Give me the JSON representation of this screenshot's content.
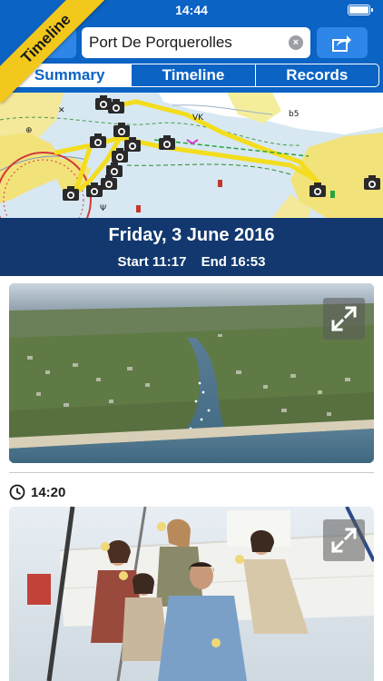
{
  "status_bar": {
    "time": "14:44"
  },
  "ribbon": {
    "label": "Timeline"
  },
  "search": {
    "value": "Port De Porquerolles"
  },
  "tabs": [
    {
      "label": "Summary",
      "active": true
    },
    {
      "label": "Timeline",
      "active": false
    },
    {
      "label": "Records",
      "active": false
    }
  ],
  "trip": {
    "date": "Friday, 3 June 2016",
    "start": "Start 11:17",
    "end": "End 16:53"
  },
  "timeline": {
    "entries": [
      {
        "time": "14:20"
      }
    ]
  },
  "colors": {
    "nav_blue": "#0b63c4",
    "header_navy": "#12386f",
    "ribbon_yellow": "#f2c81c",
    "track_yellow": "#f3dd1e"
  },
  "icons": [
    "back-icon",
    "clear-icon",
    "share-icon",
    "camera-icon",
    "expand-icon",
    "clock-icon",
    "battery-icon"
  ]
}
